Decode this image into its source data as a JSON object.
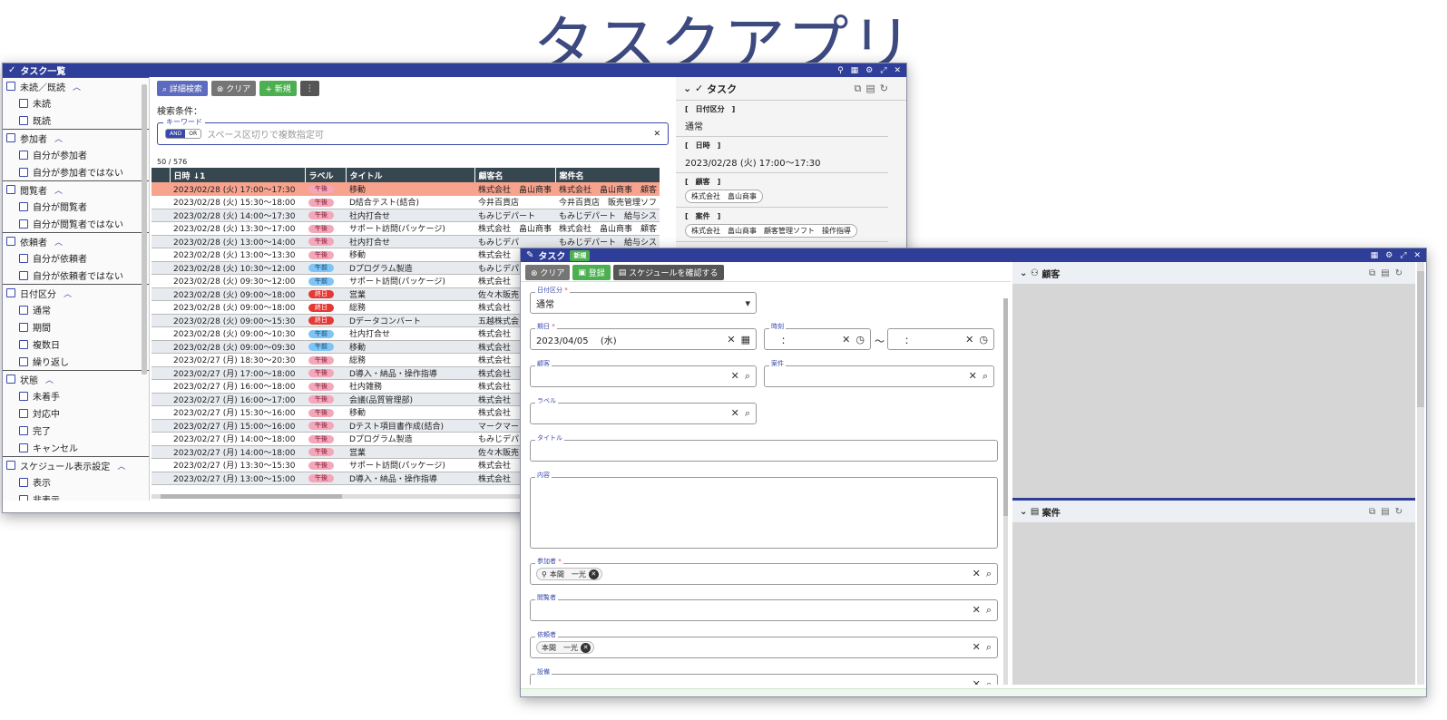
{
  "page_title": "タスクアプリ",
  "list_window": {
    "title": "タスク一覧",
    "title_icon": "✓",
    "controls": [
      "⚲",
      "▦",
      "⚙",
      "⤢",
      "✕"
    ],
    "filters": [
      {
        "label": "未読／既読",
        "items": [
          "未読",
          "既読"
        ]
      },
      {
        "label": "参加者",
        "items": [
          "自分が参加者",
          "自分が参加者ではない"
        ]
      },
      {
        "label": "閲覧者",
        "items": [
          "自分が閲覧者",
          "自分が閲覧者ではない"
        ]
      },
      {
        "label": "依頼者",
        "items": [
          "自分が依頼者",
          "自分が依頼者ではない"
        ]
      },
      {
        "label": "日付区分",
        "items": [
          "通常",
          "期間",
          "複数日",
          "繰り返し"
        ]
      },
      {
        "label": "状態",
        "items": [
          "未着手",
          "対応中",
          "完了",
          "キャンセル"
        ]
      },
      {
        "label": "スケジュール表示設定",
        "items": [
          "表示",
          "非表示"
        ]
      }
    ],
    "toolbar": {
      "search": "⌕ 詳細検索",
      "clear": "⊗ クリア",
      "new": "+ 新規",
      "more": "⋮"
    },
    "condition_label": "検索条件：",
    "keyword": {
      "label": "キーワード",
      "and": "AND",
      "or": "OR",
      "placeholder": "スペース区切りで複数指定可",
      "clear": "✕"
    },
    "count": "50 / 576",
    "columns": [
      "",
      "日時 ↓1",
      "ラベル",
      "タイトル",
      "顧客名",
      "案件名"
    ],
    "rows": [
      {
        "dt": "2023/02/28 (火) 17:00～17:30",
        "label": "午後",
        "type": "pm",
        "title": "移動",
        "customer": "株式会社　畠山商事",
        "project": "株式会社　畠山商事　顧客",
        "hl": true
      },
      {
        "dt": "2023/02/28 (火) 15:30～18:00",
        "label": "午後",
        "type": "pm",
        "title": "D結合テスト(結合)",
        "customer": "今井百貨店",
        "project": "今井百貨店　販売管理ソフ"
      },
      {
        "dt": "2023/02/28 (火) 14:00～17:30",
        "label": "午後",
        "type": "pm",
        "title": "社内打合せ",
        "customer": "もみじデパート",
        "project": "もみじデパート　給与シス"
      },
      {
        "dt": "2023/02/28 (火) 13:30～17:00",
        "label": "午後",
        "type": "pm",
        "title": "サポート訪問(パッケージ)",
        "customer": "株式会社　畠山商事",
        "project": "株式会社　畠山商事　顧客"
      },
      {
        "dt": "2023/02/28 (火) 13:00～14:00",
        "label": "午後",
        "type": "pm",
        "title": "社内打合せ",
        "customer": "もみじデパ",
        "project": "もみじデパート　給与シス"
      },
      {
        "dt": "2023/02/28 (火) 13:00～13:30",
        "label": "午後",
        "type": "pm",
        "title": "移動",
        "customer": "株式会社",
        "project": ""
      },
      {
        "dt": "2023/02/28 (火) 10:30～12:00",
        "label": "午前",
        "type": "am",
        "title": "Dプログラム製造",
        "customer": "もみじデパ",
        "project": ""
      },
      {
        "dt": "2023/02/28 (火) 09:30～12:00",
        "label": "午前",
        "type": "am",
        "title": "サポート訪問(パッケージ)",
        "customer": "株式会社",
        "project": ""
      },
      {
        "dt": "2023/02/28 (火) 09:00～18:00",
        "label": "終日",
        "type": "all",
        "title": "営業",
        "customer": "佐々木販売",
        "project": ""
      },
      {
        "dt": "2023/02/28 (火) 09:00～18:00",
        "label": "終日",
        "type": "all",
        "title": "総務",
        "customer": "株式会社",
        "project": ""
      },
      {
        "dt": "2023/02/28 (火) 09:00～15:30",
        "label": "終日",
        "type": "all",
        "title": "Dデータコンバート",
        "customer": "五越株式会",
        "project": ""
      },
      {
        "dt": "2023/02/28 (火) 09:00～10:30",
        "label": "午前",
        "type": "am",
        "title": "社内打合せ",
        "customer": "株式会社",
        "project": ""
      },
      {
        "dt": "2023/02/28 (火) 09:00～09:30",
        "label": "午前",
        "type": "am",
        "title": "移動",
        "customer": "株式会社",
        "project": ""
      },
      {
        "dt": "2023/02/27 (月) 18:30～20:30",
        "label": "午後",
        "type": "pm",
        "title": "総務",
        "customer": "株式会社",
        "project": ""
      },
      {
        "dt": "2023/02/27 (月) 17:00～18:00",
        "label": "午後",
        "type": "pm",
        "title": "D導入・納品・操作指導",
        "customer": "株式会社",
        "project": ""
      },
      {
        "dt": "2023/02/27 (月) 16:00～18:00",
        "label": "午後",
        "type": "pm",
        "title": "社内雑務",
        "customer": "株式会社",
        "project": ""
      },
      {
        "dt": "2023/02/27 (月) 16:00～17:00",
        "label": "午後",
        "type": "pm",
        "title": "会議(品質管理部)",
        "customer": "株式会社",
        "project": ""
      },
      {
        "dt": "2023/02/27 (月) 15:30～16:00",
        "label": "午後",
        "type": "pm",
        "title": "移動",
        "customer": "株式会社",
        "project": ""
      },
      {
        "dt": "2023/02/27 (月) 15:00～16:00",
        "label": "午後",
        "type": "pm",
        "title": "Dテスト項目書作成(結合)",
        "customer": "マークマー",
        "project": ""
      },
      {
        "dt": "2023/02/27 (月) 14:00～18:00",
        "label": "午後",
        "type": "pm",
        "title": "Dプログラム製造",
        "customer": "もみじデパ",
        "project": ""
      },
      {
        "dt": "2023/02/27 (月) 14:00～18:00",
        "label": "午後",
        "type": "pm",
        "title": "営業",
        "customer": "佐々木販売",
        "project": ""
      },
      {
        "dt": "2023/02/27 (月) 13:30～15:30",
        "label": "午後",
        "type": "pm",
        "title": "サポート訪問(パッケージ)",
        "customer": "株式会社",
        "project": ""
      },
      {
        "dt": "2023/02/27 (月) 13:00～15:00",
        "label": "午後",
        "type": "pm",
        "title": "D導入・納品・操作指導",
        "customer": "株式会社",
        "project": ""
      }
    ],
    "detail": {
      "title": "タスク",
      "date_type_h": "[　日付区分　]",
      "date_type_v": "通常",
      "datetime_h": "[　日時　]",
      "datetime_v": "2023/02/28 (火) 17:00～17:30",
      "customer_h": "[　顧客　]",
      "customer_v": "株式会社　畠山商事",
      "project_h": "[　案件　]",
      "project_v": "株式会社　畠山商事　顧客管理ソフト　操作指導"
    }
  },
  "edit_window": {
    "title": "タスク",
    "badge": "新規",
    "toolbar": {
      "clear": "⊗ クリア",
      "save": "登録",
      "schedule": "スケジュールを確認する"
    },
    "fields": {
      "date_type_label": "日付区分",
      "date_type_value": "通常",
      "due_label": "期日",
      "due_value": "2023/04/05　 (水)",
      "time_label": "時刻",
      "time_from": "：",
      "time_sep": "～",
      "time_to": "：",
      "customer_label": "顧客",
      "project_label": "案件",
      "label_label": "ラベル",
      "title_label": "タイトル",
      "content_label": "内容",
      "participant_label": "参加者",
      "participant_value": "本間　一光",
      "viewer_label": "閲覧者",
      "requester_label": "依頼者",
      "requester_value": "本間　一光",
      "equipment_label": "設備"
    },
    "side": {
      "customer_panel": "顧客",
      "project_panel": "案件"
    }
  }
}
